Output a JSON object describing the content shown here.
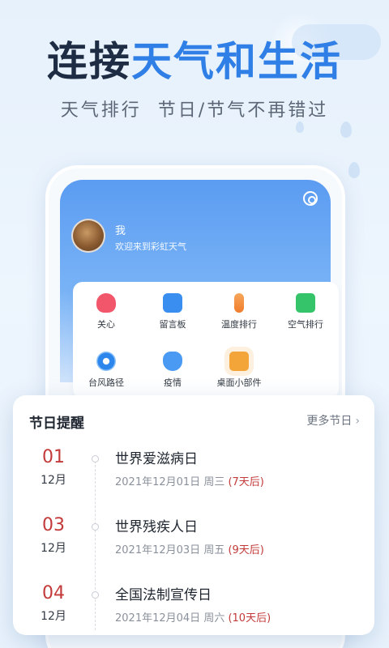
{
  "hero": {
    "title_part1": "连接",
    "title_part2": "天气和生活",
    "subtitle": "天气排行  节日/节气不再错过"
  },
  "profile": {
    "name": "我",
    "welcome": "欢迎来到彩虹天气"
  },
  "grid": {
    "items": [
      {
        "label": "关心",
        "icon": "heart-plus-icon"
      },
      {
        "label": "留言板",
        "icon": "chat-bubble-icon"
      },
      {
        "label": "温度排行",
        "icon": "thermometer-icon"
      },
      {
        "label": "空气排行",
        "icon": "bar-chart-icon"
      },
      {
        "label": "台风路径",
        "icon": "typhoon-icon"
      },
      {
        "label": "疫情",
        "icon": "lungs-icon"
      },
      {
        "label": "桌面小部件",
        "icon": "puzzle-icon"
      }
    ]
  },
  "holidays": {
    "title": "节日提醒",
    "more": "更多节日",
    "events": [
      {
        "day": "01",
        "month": "12月",
        "name": "世界爱滋病日",
        "date": "2021年12月01日",
        "weekday": "周三",
        "after": "(7天后)"
      },
      {
        "day": "03",
        "month": "12月",
        "name": "世界残疾人日",
        "date": "2021年12月03日",
        "weekday": "周五",
        "after": "(9天后)"
      },
      {
        "day": "04",
        "month": "12月",
        "name": "全国法制宣传日",
        "date": "2021年12月04日",
        "weekday": "周六",
        "after": "(10天后)"
      }
    ]
  },
  "colors": {
    "accent": "#2f7fe6",
    "headline": "#1e2c44",
    "date_red": "#c33a3a",
    "header_blue": "#5b9cf2"
  }
}
